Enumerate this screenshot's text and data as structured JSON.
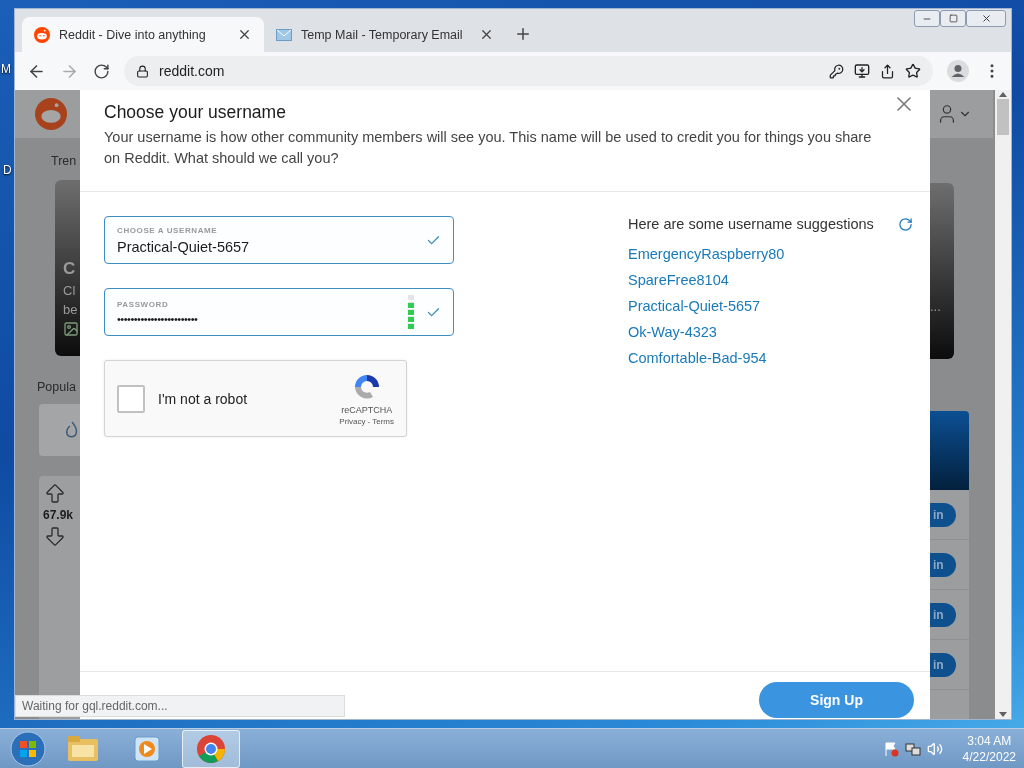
{
  "desktop_labels": [
    "M",
    "D"
  ],
  "browser": {
    "tabs": [
      {
        "title": "Reddit - Dive into anything",
        "selected": true
      },
      {
        "title": "Temp Mail - Temporary Email",
        "selected": false
      }
    ],
    "address": "reddit.com",
    "status": "Waiting for gql.reddit.com..."
  },
  "background_page": {
    "trending": "Tren",
    "card_lines": [
      "C",
      "Cl",
      "be"
    ],
    "popular": "Popula",
    "votes": "67.9k",
    "right_card_text": "...",
    "join_buttons": [
      "in",
      "in",
      "in",
      "in"
    ]
  },
  "modal": {
    "title": "Choose your username",
    "description": "Your username is how other community members will see you. This name will be used to credit you for things you share on Reddit. What should we call you?",
    "username": {
      "label": "CHOOSE A USERNAME",
      "value": "Practical-Quiet-5657",
      "valid": true
    },
    "password": {
      "label": "PASSWORD",
      "value": "••••••••••••••••••••••••",
      "valid": true,
      "strength": {
        "level": 0.8
      }
    },
    "captcha": {
      "label": "I'm not a robot",
      "checked": false,
      "brand": "reCAPTCHA",
      "privacy": "Privacy",
      "separator": "-",
      "terms": "Terms"
    },
    "suggestions": {
      "heading": "Here are some username suggestions",
      "items": [
        "EmergencyRaspberry80",
        "SpareFree8104",
        "Practical-Quiet-5657",
        "Ok-Way-4323",
        "Comfortable-Bad-954"
      ]
    },
    "submit": "Sign Up"
  },
  "taskbar": {
    "apps": [
      {
        "kind": "folder",
        "selected": false
      },
      {
        "kind": "media",
        "selected": false
      },
      {
        "kind": "chrome",
        "selected": true
      }
    ],
    "time": "3:04 AM",
    "date": "4/22/2022"
  }
}
